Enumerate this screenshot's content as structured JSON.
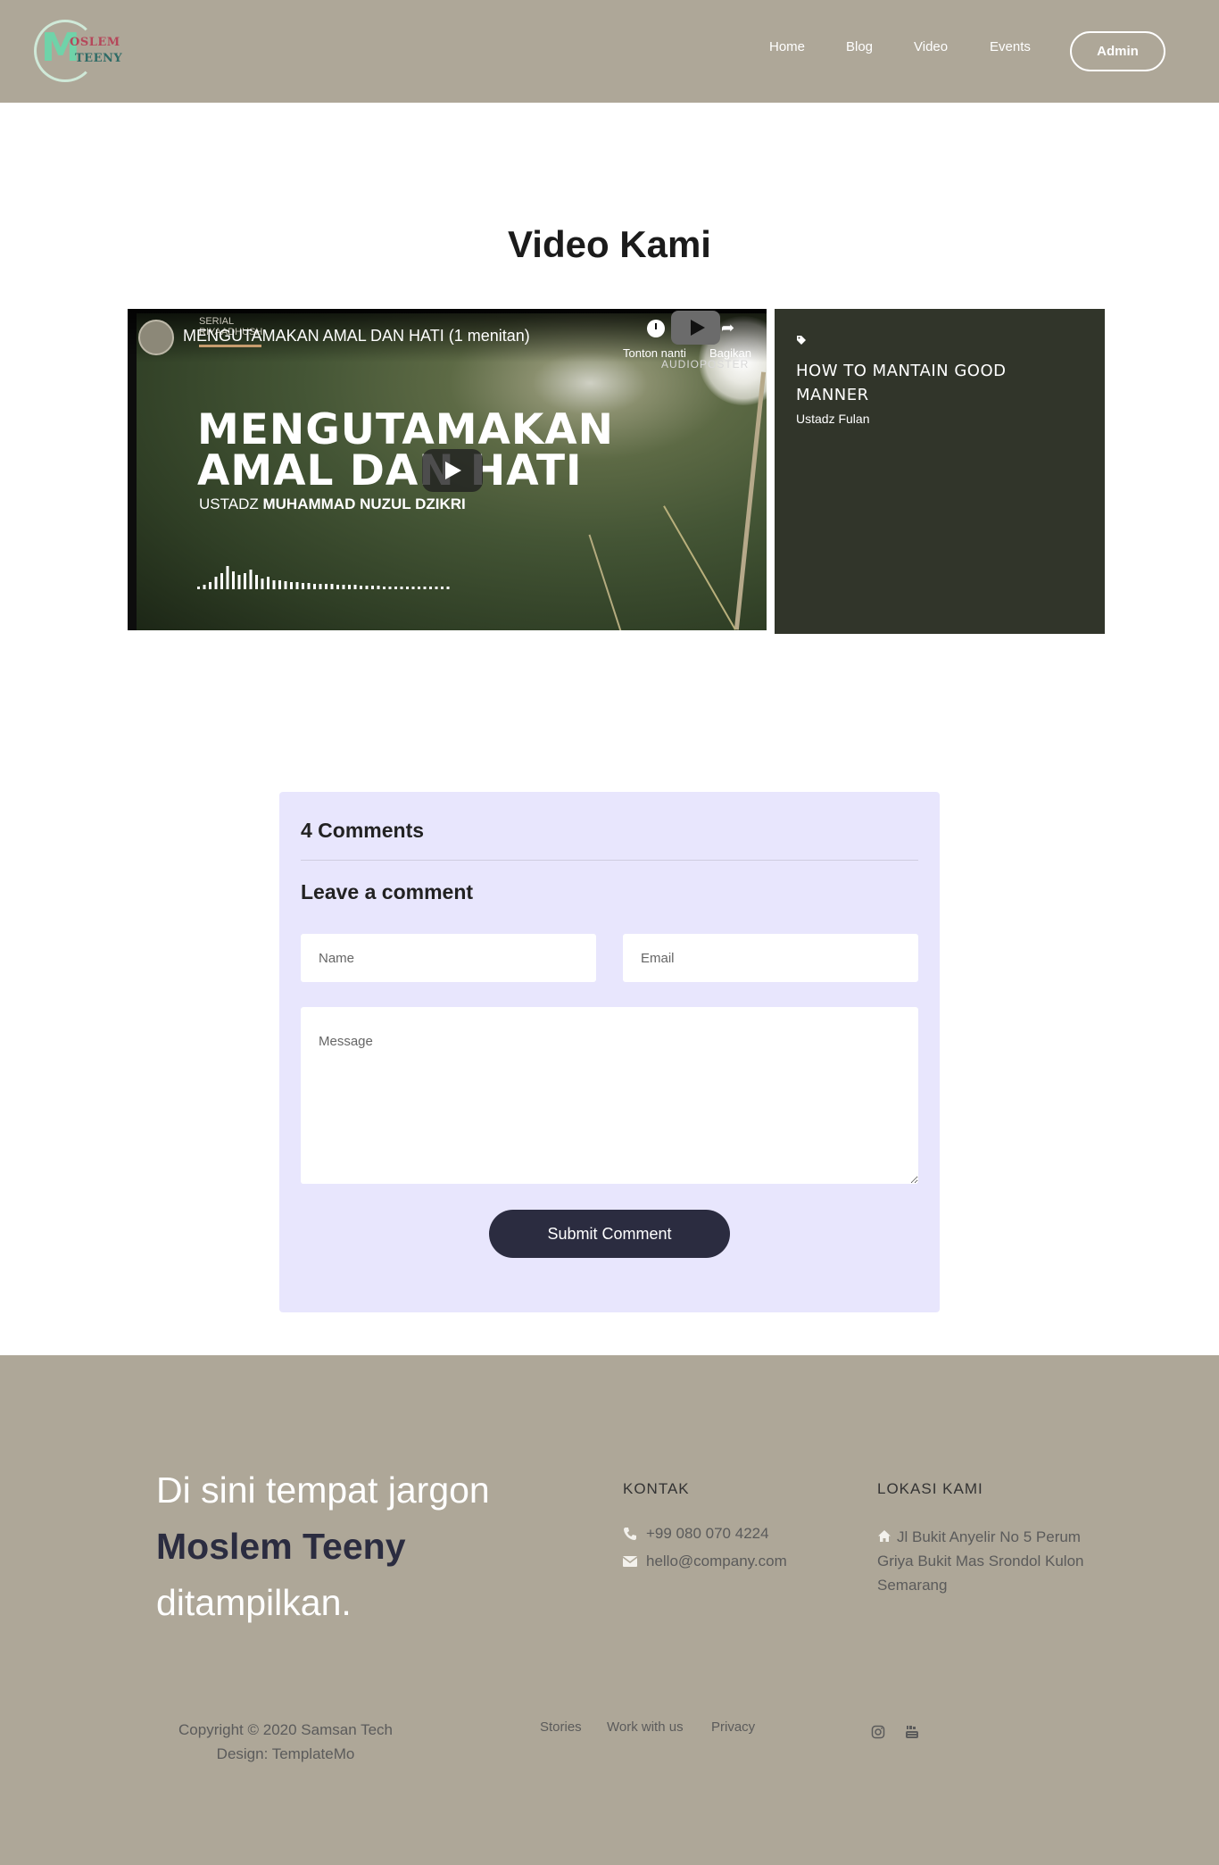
{
  "header": {
    "logo": {
      "line1": "OSLEM",
      "line2": "TEENY",
      "initial": "M"
    },
    "nav": [
      "Home",
      "Blog",
      "Video",
      "Events"
    ],
    "admin_label": "Admin"
  },
  "section": {
    "title": "Video Kami"
  },
  "video": {
    "caption": "MENGUTAMAKAN AMAL DAN HATI (1 menitan)",
    "serial_line1": "SERIAL",
    "serial_line2": "RIYAADHUSH",
    "watch_later_label": "Tonton nanti",
    "share_label": "Bagikan",
    "audioposter": "AUDIOPOSTER",
    "title_line1": "MENGUTAMAKAN",
    "title_line2": "AMAL DAN HATI",
    "speaker_prefix": "USTADZ",
    "speaker_name": "MUHAMMAD NUZUL DZIKRI"
  },
  "info": {
    "icon": "tag-icon",
    "title": "HOW TO MANTAIN GOOD MANNER",
    "author": "Ustadz Fulan"
  },
  "comments": {
    "count_label": "4 Comments",
    "leave_title": "Leave a comment",
    "name_placeholder": "Name",
    "email_placeholder": "Email",
    "message_placeholder": "Message",
    "submit_label": "Submit Comment"
  },
  "footer": {
    "tagline_line1": "Di sini tempat jargon",
    "tagline_brand": "Moslem Teeny",
    "tagline_line3": "ditampilkan.",
    "kontak_heading": "KONTAK",
    "phone": "+99 080 070 4224",
    "email": "hello@company.com",
    "lokasi_heading": "LOKASI KAMI",
    "address": "Jl Bukit Anyelir No 5 Perum Griya Bukit Mas Srondol Kulon Semarang",
    "copyright_line1": "Copyright © 2020 Samsan Tech",
    "copyright_line2": "Design: TemplateMo",
    "links": [
      "Stories",
      "Work with us",
      "Privacy"
    ],
    "social": [
      "instagram-icon",
      "youtube-icon"
    ]
  },
  "colors": {
    "header_bg": "#aea798",
    "panel_bg": "#31352a",
    "comments_bg": "#e8e6fd",
    "button_bg": "#2b2c40"
  }
}
